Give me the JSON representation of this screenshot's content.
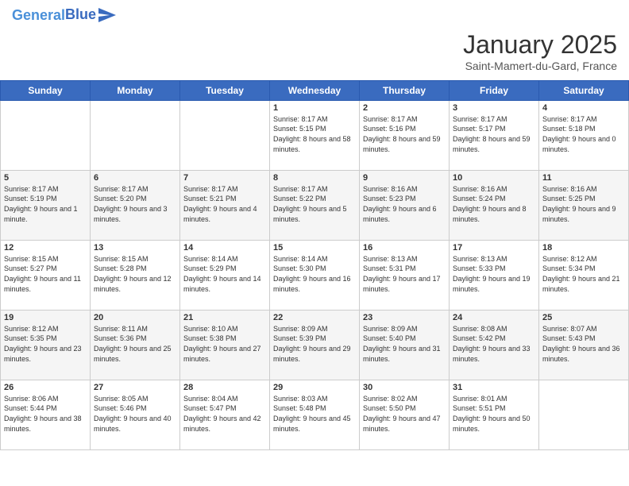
{
  "header": {
    "logo_line1": "General",
    "logo_line2": "Blue",
    "month_title": "January 2025",
    "location": "Saint-Mamert-du-Gard, France"
  },
  "weekdays": [
    "Sunday",
    "Monday",
    "Tuesday",
    "Wednesday",
    "Thursday",
    "Friday",
    "Saturday"
  ],
  "days": [
    {
      "num": "",
      "sunrise": "",
      "sunset": "",
      "daylight": ""
    },
    {
      "num": "",
      "sunrise": "",
      "sunset": "",
      "daylight": ""
    },
    {
      "num": "",
      "sunrise": "",
      "sunset": "",
      "daylight": ""
    },
    {
      "num": "1",
      "sunrise": "Sunrise: 8:17 AM",
      "sunset": "Sunset: 5:15 PM",
      "daylight": "Daylight: 8 hours and 58 minutes."
    },
    {
      "num": "2",
      "sunrise": "Sunrise: 8:17 AM",
      "sunset": "Sunset: 5:16 PM",
      "daylight": "Daylight: 8 hours and 59 minutes."
    },
    {
      "num": "3",
      "sunrise": "Sunrise: 8:17 AM",
      "sunset": "Sunset: 5:17 PM",
      "daylight": "Daylight: 8 hours and 59 minutes."
    },
    {
      "num": "4",
      "sunrise": "Sunrise: 8:17 AM",
      "sunset": "Sunset: 5:18 PM",
      "daylight": "Daylight: 9 hours and 0 minutes."
    },
    {
      "num": "5",
      "sunrise": "Sunrise: 8:17 AM",
      "sunset": "Sunset: 5:19 PM",
      "daylight": "Daylight: 9 hours and 1 minute."
    },
    {
      "num": "6",
      "sunrise": "Sunrise: 8:17 AM",
      "sunset": "Sunset: 5:20 PM",
      "daylight": "Daylight: 9 hours and 3 minutes."
    },
    {
      "num": "7",
      "sunrise": "Sunrise: 8:17 AM",
      "sunset": "Sunset: 5:21 PM",
      "daylight": "Daylight: 9 hours and 4 minutes."
    },
    {
      "num": "8",
      "sunrise": "Sunrise: 8:17 AM",
      "sunset": "Sunset: 5:22 PM",
      "daylight": "Daylight: 9 hours and 5 minutes."
    },
    {
      "num": "9",
      "sunrise": "Sunrise: 8:16 AM",
      "sunset": "Sunset: 5:23 PM",
      "daylight": "Daylight: 9 hours and 6 minutes."
    },
    {
      "num": "10",
      "sunrise": "Sunrise: 8:16 AM",
      "sunset": "Sunset: 5:24 PM",
      "daylight": "Daylight: 9 hours and 8 minutes."
    },
    {
      "num": "11",
      "sunrise": "Sunrise: 8:16 AM",
      "sunset": "Sunset: 5:25 PM",
      "daylight": "Daylight: 9 hours and 9 minutes."
    },
    {
      "num": "12",
      "sunrise": "Sunrise: 8:15 AM",
      "sunset": "Sunset: 5:27 PM",
      "daylight": "Daylight: 9 hours and 11 minutes."
    },
    {
      "num": "13",
      "sunrise": "Sunrise: 8:15 AM",
      "sunset": "Sunset: 5:28 PM",
      "daylight": "Daylight: 9 hours and 12 minutes."
    },
    {
      "num": "14",
      "sunrise": "Sunrise: 8:14 AM",
      "sunset": "Sunset: 5:29 PM",
      "daylight": "Daylight: 9 hours and 14 minutes."
    },
    {
      "num": "15",
      "sunrise": "Sunrise: 8:14 AM",
      "sunset": "Sunset: 5:30 PM",
      "daylight": "Daylight: 9 hours and 16 minutes."
    },
    {
      "num": "16",
      "sunrise": "Sunrise: 8:13 AM",
      "sunset": "Sunset: 5:31 PM",
      "daylight": "Daylight: 9 hours and 17 minutes."
    },
    {
      "num": "17",
      "sunrise": "Sunrise: 8:13 AM",
      "sunset": "Sunset: 5:33 PM",
      "daylight": "Daylight: 9 hours and 19 minutes."
    },
    {
      "num": "18",
      "sunrise": "Sunrise: 8:12 AM",
      "sunset": "Sunset: 5:34 PM",
      "daylight": "Daylight: 9 hours and 21 minutes."
    },
    {
      "num": "19",
      "sunrise": "Sunrise: 8:12 AM",
      "sunset": "Sunset: 5:35 PM",
      "daylight": "Daylight: 9 hours and 23 minutes."
    },
    {
      "num": "20",
      "sunrise": "Sunrise: 8:11 AM",
      "sunset": "Sunset: 5:36 PM",
      "daylight": "Daylight: 9 hours and 25 minutes."
    },
    {
      "num": "21",
      "sunrise": "Sunrise: 8:10 AM",
      "sunset": "Sunset: 5:38 PM",
      "daylight": "Daylight: 9 hours and 27 minutes."
    },
    {
      "num": "22",
      "sunrise": "Sunrise: 8:09 AM",
      "sunset": "Sunset: 5:39 PM",
      "daylight": "Daylight: 9 hours and 29 minutes."
    },
    {
      "num": "23",
      "sunrise": "Sunrise: 8:09 AM",
      "sunset": "Sunset: 5:40 PM",
      "daylight": "Daylight: 9 hours and 31 minutes."
    },
    {
      "num": "24",
      "sunrise": "Sunrise: 8:08 AM",
      "sunset": "Sunset: 5:42 PM",
      "daylight": "Daylight: 9 hours and 33 minutes."
    },
    {
      "num": "25",
      "sunrise": "Sunrise: 8:07 AM",
      "sunset": "Sunset: 5:43 PM",
      "daylight": "Daylight: 9 hours and 36 minutes."
    },
    {
      "num": "26",
      "sunrise": "Sunrise: 8:06 AM",
      "sunset": "Sunset: 5:44 PM",
      "daylight": "Daylight: 9 hours and 38 minutes."
    },
    {
      "num": "27",
      "sunrise": "Sunrise: 8:05 AM",
      "sunset": "Sunset: 5:46 PM",
      "daylight": "Daylight: 9 hours and 40 minutes."
    },
    {
      "num": "28",
      "sunrise": "Sunrise: 8:04 AM",
      "sunset": "Sunset: 5:47 PM",
      "daylight": "Daylight: 9 hours and 42 minutes."
    },
    {
      "num": "29",
      "sunrise": "Sunrise: 8:03 AM",
      "sunset": "Sunset: 5:48 PM",
      "daylight": "Daylight: 9 hours and 45 minutes."
    },
    {
      "num": "30",
      "sunrise": "Sunrise: 8:02 AM",
      "sunset": "Sunset: 5:50 PM",
      "daylight": "Daylight: 9 hours and 47 minutes."
    },
    {
      "num": "31",
      "sunrise": "Sunrise: 8:01 AM",
      "sunset": "Sunset: 5:51 PM",
      "daylight": "Daylight: 9 hours and 50 minutes."
    },
    {
      "num": "",
      "sunrise": "",
      "sunset": "",
      "daylight": ""
    }
  ]
}
